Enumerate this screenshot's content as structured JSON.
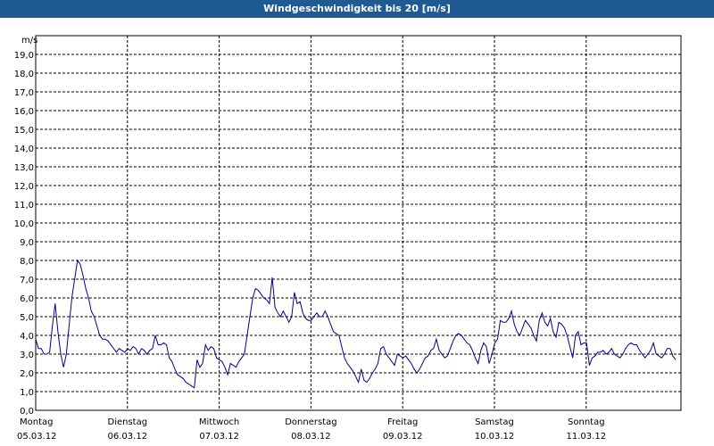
{
  "window": {
    "title": "Windgeschwindigkeit bis 20 [m/s]"
  },
  "colors": {
    "titlebar": "#1f5a93",
    "series": "#00008b",
    "grid": "#000000"
  },
  "chart_data": {
    "type": "line",
    "title": "Windgeschwindigkeit bis 20 [m/s]",
    "ylabel": "m/s",
    "ylim": [
      0,
      20
    ],
    "yticks": [
      "0,0",
      "1,0",
      "2,0",
      "3,0",
      "4,0",
      "5,0",
      "6,0",
      "7,0",
      "8,0",
      "9,0",
      "10,0",
      "11,0",
      "12,0",
      "13,0",
      "14,0",
      "15,0",
      "16,0",
      "17,0",
      "18,0",
      "19,0"
    ],
    "x_ticks": [
      {
        "day": "Montag",
        "date": "05.03.12"
      },
      {
        "day": "Dienstag",
        "date": "06.03.12"
      },
      {
        "day": "Mittwoch",
        "date": "07.03.12"
      },
      {
        "day": "Donnerstag",
        "date": "08.03.12"
      },
      {
        "day": "Freitag",
        "date": "09.03.12"
      },
      {
        "day": "Samstag",
        "date": "10.03.12"
      },
      {
        "day": "Sonntag",
        "date": "11.03.12"
      }
    ],
    "grid": true,
    "series": [
      {
        "values": [
          3.8,
          3.3,
          3.3,
          3.0,
          3.0,
          3.1,
          4.5,
          5.7,
          4.2,
          3.0,
          2.3,
          3.0,
          4.5,
          6.0,
          7.0,
          8.0,
          7.8,
          7.2,
          6.5,
          6.0,
          5.3,
          5.0,
          4.5,
          4.0,
          3.8,
          3.8,
          3.7,
          3.5,
          3.3,
          3.1,
          3.3,
          3.2,
          3.1,
          3.3,
          3.2,
          3.4,
          3.3,
          3.0,
          3.3,
          3.2,
          3.0,
          3.2,
          3.3,
          4.0,
          3.5,
          3.5,
          3.6,
          3.5,
          2.8,
          2.6,
          2.2,
          1.9,
          1.8,
          1.7,
          1.5,
          1.4,
          1.3,
          1.2,
          2.7,
          2.3,
          2.5,
          3.5,
          3.2,
          3.4,
          3.3,
          2.8,
          2.7,
          2.6,
          2.3,
          1.9,
          2.5,
          2.4,
          2.3,
          2.6,
          2.8,
          3.0,
          4.0,
          5.0,
          6.0,
          6.5,
          6.4,
          6.2,
          6.0,
          5.9,
          5.7,
          7.1,
          5.5,
          5.2,
          5.0,
          5.3,
          5.0,
          4.7,
          5.0,
          6.3,
          5.7,
          5.8,
          5.2,
          4.9,
          4.8,
          4.8,
          5.0,
          5.2,
          5.0,
          5.0,
          5.3,
          5.0,
          4.6,
          4.2,
          4.1,
          4.0,
          3.4,
          2.8,
          2.5,
          2.3,
          2.1,
          1.8,
          1.5,
          2.2,
          1.6,
          1.5,
          1.7,
          2.0,
          2.2,
          2.5,
          3.3,
          3.4,
          3.0,
          2.8,
          2.6,
          2.4,
          3.0,
          2.9,
          2.8,
          2.9,
          2.7,
          2.5,
          2.2,
          2.0,
          2.2,
          2.5,
          2.8,
          2.9,
          3.2,
          3.3,
          3.8,
          3.2,
          3.0,
          2.8,
          2.9,
          3.3,
          3.7,
          4.0,
          4.1,
          4.0,
          3.8,
          3.6,
          3.5,
          3.2,
          2.8,
          2.5,
          3.2,
          3.6,
          3.4,
          2.5,
          3.0,
          3.6,
          3.8,
          4.8,
          4.7,
          4.7,
          4.9,
          5.3,
          4.6,
          4.2,
          4.0,
          4.4,
          4.8,
          4.6,
          4.4,
          4.0,
          3.7,
          4.8,
          5.2,
          4.7,
          4.5,
          4.9,
          4.2,
          3.9,
          4.7,
          4.6,
          4.4,
          4.0,
          3.4,
          2.8,
          4.0,
          4.2,
          3.5,
          3.6,
          3.6,
          2.4,
          2.8,
          2.9,
          3.1,
          3.1,
          3.2,
          3.0,
          3.1,
          3.3,
          3.0,
          2.9,
          2.8,
          3.0,
          3.3,
          3.5,
          3.6,
          3.5,
          3.5,
          3.2,
          3.0,
          2.8,
          3.0,
          3.2,
          3.6,
          3.0,
          2.9,
          2.8,
          3.0,
          3.3,
          3.3,
          2.9,
          2.7
        ]
      }
    ]
  }
}
